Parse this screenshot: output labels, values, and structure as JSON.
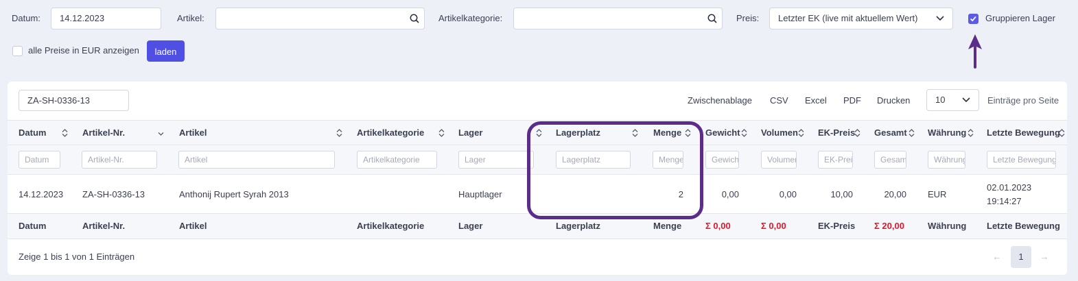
{
  "filters": {
    "datum_label": "Datum:",
    "datum_value": "14.12.2023",
    "artikel_label": "Artikel:",
    "artikel_value": "",
    "kategorie_label": "Artikelkategorie:",
    "kategorie_value": "",
    "preis_label": "Preis:",
    "preis_value": "Letzter EK (live mit aktuellem Wert)",
    "gruppieren_label": "Gruppieren Lager",
    "gruppieren_checked": true,
    "eur_label": "alle Preise in EUR anzeigen",
    "eur_checked": false,
    "load_label": "laden"
  },
  "table_toolbar": {
    "search_value": "ZA-SH-0336-13",
    "export_buttons": [
      "Zwischenablage",
      "CSV",
      "Excel",
      "PDF",
      "Drucken"
    ],
    "page_size": "10",
    "page_size_label": "Einträge pro Seite"
  },
  "table": {
    "headers": [
      "Datum",
      "Artikel-Nr.",
      "Artikel",
      "Artikelkategorie",
      "Lager",
      "Lagerplatz",
      "Menge",
      "Gewicht",
      "Volumen",
      "EK-Preis",
      "Gesamt",
      "Währung",
      "Letzte Bewegung"
    ],
    "filter_placeholders": [
      "Datum",
      "Artikel-Nr.",
      "Artikel",
      "Artikelkategorie",
      "Lager",
      "Lagerplatz",
      "Menge",
      "Gewicht",
      "Volumen",
      "EK-Preis",
      "Gesamt",
      "Währung",
      "Letzte Bewegung"
    ],
    "rows": [
      {
        "datum": "14.12.2023",
        "artikel_nr": "ZA-SH-0336-13",
        "artikel": "Anthonij Rupert Syrah 2013",
        "kategorie": "",
        "lager": "Hauptlager",
        "lagerplatz": "",
        "menge": "2",
        "gewicht": "0,00",
        "volumen": "0,00",
        "ek_preis": "10,00",
        "gesamt": "20,00",
        "waehrung": "EUR",
        "bewegung_date": "02.01.2023",
        "bewegung_time": "19:14:27"
      }
    ],
    "footer": {
      "datum": "Datum",
      "artikel_nr": "Artikel-Nr.",
      "artikel": "Artikel",
      "kategorie": "Artikelkategorie",
      "lager": "Lager",
      "lagerplatz": "Lagerplatz",
      "menge": "Menge",
      "gewicht": "Σ 0,00",
      "volumen": "Σ 0,00",
      "ek_preis": "EK-Preis",
      "gesamt": "Σ 20,00",
      "waehrung": "Währung",
      "bewegung": "Letzte Bewegung"
    }
  },
  "pagination": {
    "info": "Zeige 1 bis 1 von 1 Einträgen",
    "current_page": "1",
    "prev_icon": "←",
    "next_icon": "→"
  },
  "colors": {
    "accent": "#4f50e3",
    "annotation": "#5b2c8a",
    "sum_red": "#e0192a"
  }
}
